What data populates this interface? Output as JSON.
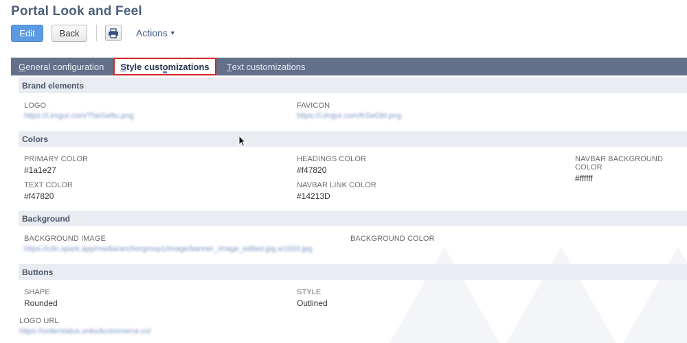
{
  "page": {
    "title": "Portal Look and Feel"
  },
  "toolbar": {
    "edit_label": "Edit",
    "back_label": "Back",
    "actions_label": "Actions"
  },
  "tabs": [
    {
      "label": "General configuration",
      "accel": "G",
      "rest": "eneral configuration",
      "active": false
    },
    {
      "label": "Style customizations",
      "accel": "S",
      "rest": "tyle customizations",
      "active": true
    },
    {
      "label": "Text customizations",
      "accel": "T",
      "rest": "ext customizations",
      "active": false
    }
  ],
  "sections": {
    "brand": {
      "title": "Brand elements",
      "logo_label": "LOGO",
      "logo_value": "https://i.imgur.com/TheGe8u.png",
      "favicon_label": "FAVICON",
      "favicon_value": "https://i.imgur.com/KGeDbl.png"
    },
    "colors": {
      "title": "Colors",
      "primary_label": "PRIMARY COLOR",
      "primary_value": "#1a1e27",
      "headings_label": "HEADINGS COLOR",
      "headings_value": "#f47820",
      "navbar_bg_label": "NAVBAR BACKGROUND COLOR",
      "navbar_bg_value": "#ffffff",
      "text_label": "TEXT COLOR",
      "text_value": "#f47820",
      "navbar_link_label": "NAVBAR LINK COLOR",
      "navbar_link_value": "#14213D"
    },
    "background": {
      "title": "Background",
      "image_label": "BACKGROUND IMAGE",
      "image_value": "https://cdn.spark.app/media/anchorgroup1/image/banner_image_edited.jpg.w1920.jpg",
      "color_label": "BACKGROUND COLOR"
    },
    "buttons": {
      "title": "Buttons",
      "shape_label": "SHAPE",
      "shape_value": "Rounded",
      "style_label": "STYLE",
      "style_value": "Outlined"
    },
    "logo_url": {
      "label": "LOGO URL",
      "value": "https://orderstatus.unlockcommerce.co/"
    }
  },
  "colors": {
    "tabbar": "#62708a",
    "active_outline": "#d62828",
    "edit_button": "#5b9be4",
    "section_header": "#e9ecf1",
    "title": "#4d5f7c"
  }
}
